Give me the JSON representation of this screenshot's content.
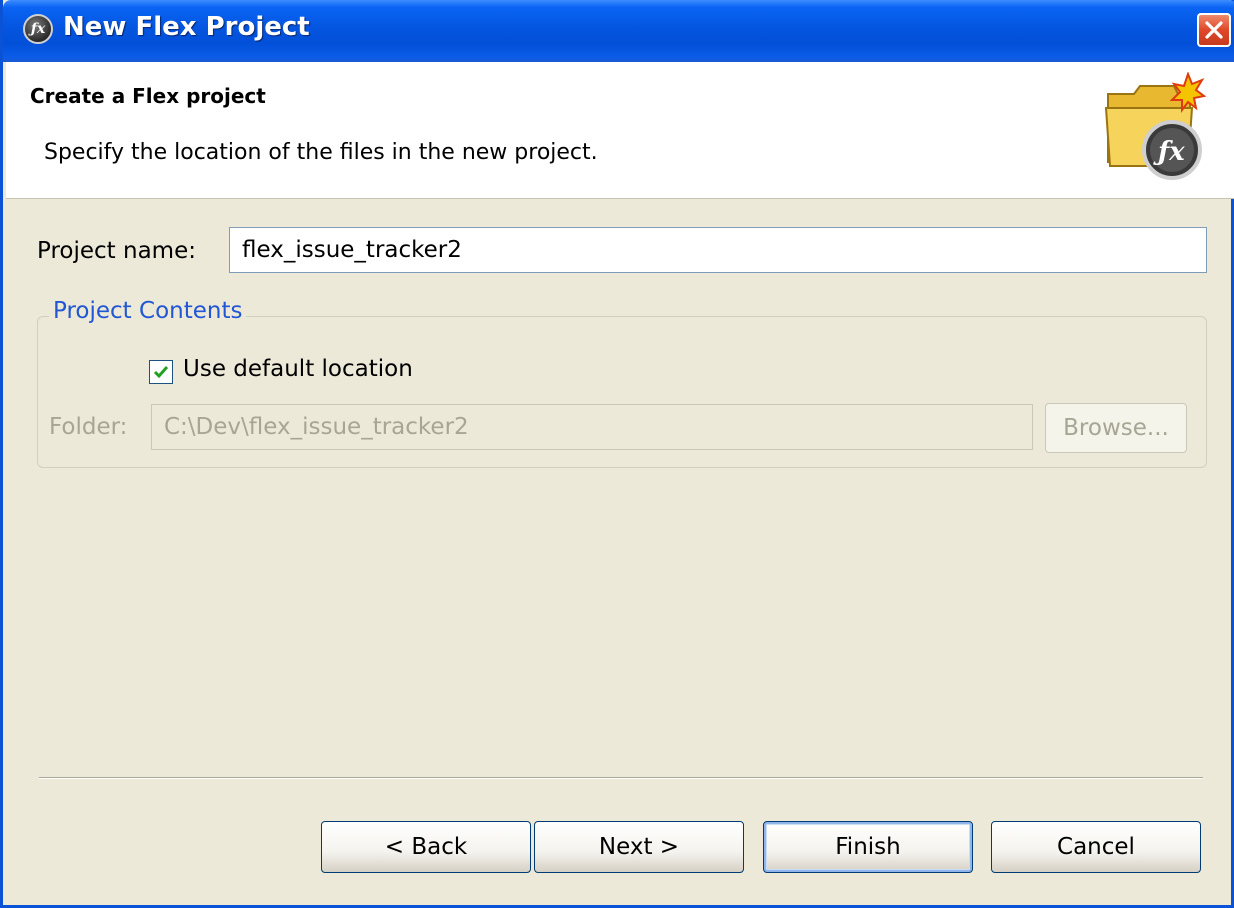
{
  "window": {
    "title": "New Flex Project",
    "title_icon_glyph": "ƒx",
    "close_icon": "close-x-icon"
  },
  "banner": {
    "title": "Create a Flex project",
    "description": "Specify the location of the files in the new project.",
    "icon": "flex-folder-icon"
  },
  "form": {
    "project_name_label": "Project name:",
    "project_name_value": "flex_issue_tracker2",
    "group_label": "Project Contents",
    "use_default_label": "Use default location",
    "use_default_checked": true,
    "folder_label": "Folder:",
    "folder_value": "C:\\Dev\\flex_issue_tracker2",
    "browse_label": "Browse..."
  },
  "buttons": {
    "back": "< Back",
    "next": "Next >",
    "finish": "Finish",
    "cancel": "Cancel"
  },
  "colors": {
    "titlebar": "#0455e0",
    "accent_text": "#2157d4",
    "dialog_bg": "#ece9d8"
  }
}
